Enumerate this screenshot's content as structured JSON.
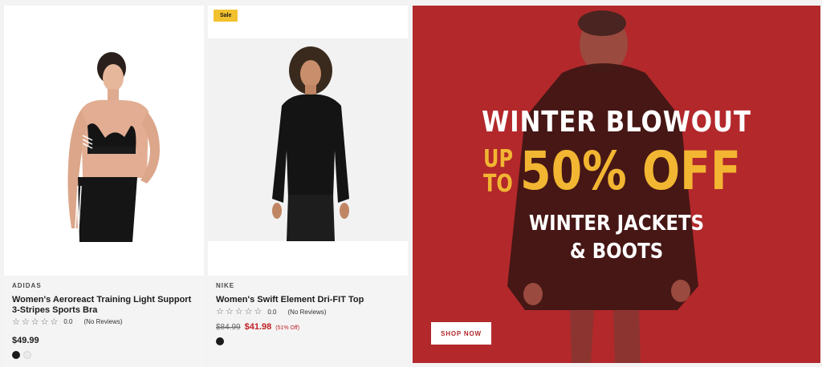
{
  "products": [
    {
      "brand": "ADIDAS",
      "title": "Women's Aeroreact Training Light Support 3-Stripes Sports Bra",
      "rating_score": "0.0",
      "reviews": "(No Reviews)",
      "price": "$49.99",
      "swatch_colors": [
        "#1a1a1a",
        "#e9e9e9"
      ],
      "image_icon": "adidas-sports-bra-model-photo"
    },
    {
      "badge": "Sale",
      "brand": "NIKE",
      "title": "Women's Swift Element Dri-FIT Top",
      "rating_score": "0.0",
      "reviews": "(No Reviews)",
      "old_price": "$84.99",
      "sale_price": "$41.98",
      "discount": "(51% Off)",
      "swatch_colors": [
        "#1a1a1a"
      ],
      "image_icon": "nike-dri-fit-top-model-photo"
    }
  ],
  "banner": {
    "headline": "WINTER BLOWOUT",
    "upto": "UP TO",
    "discount": "50% OFF",
    "sub_line1": "WINTER JACKETS",
    "sub_line2": "& BOOTS",
    "cta": "SHOP NOW",
    "background_color": "#b3282b",
    "accent_color": "#f2b632",
    "image_icon": "man-in-puffer-jacket-photo"
  },
  "star_glyph": "☆",
  "colors": {
    "sale": "#c32125",
    "badge": "#f2c12e"
  }
}
